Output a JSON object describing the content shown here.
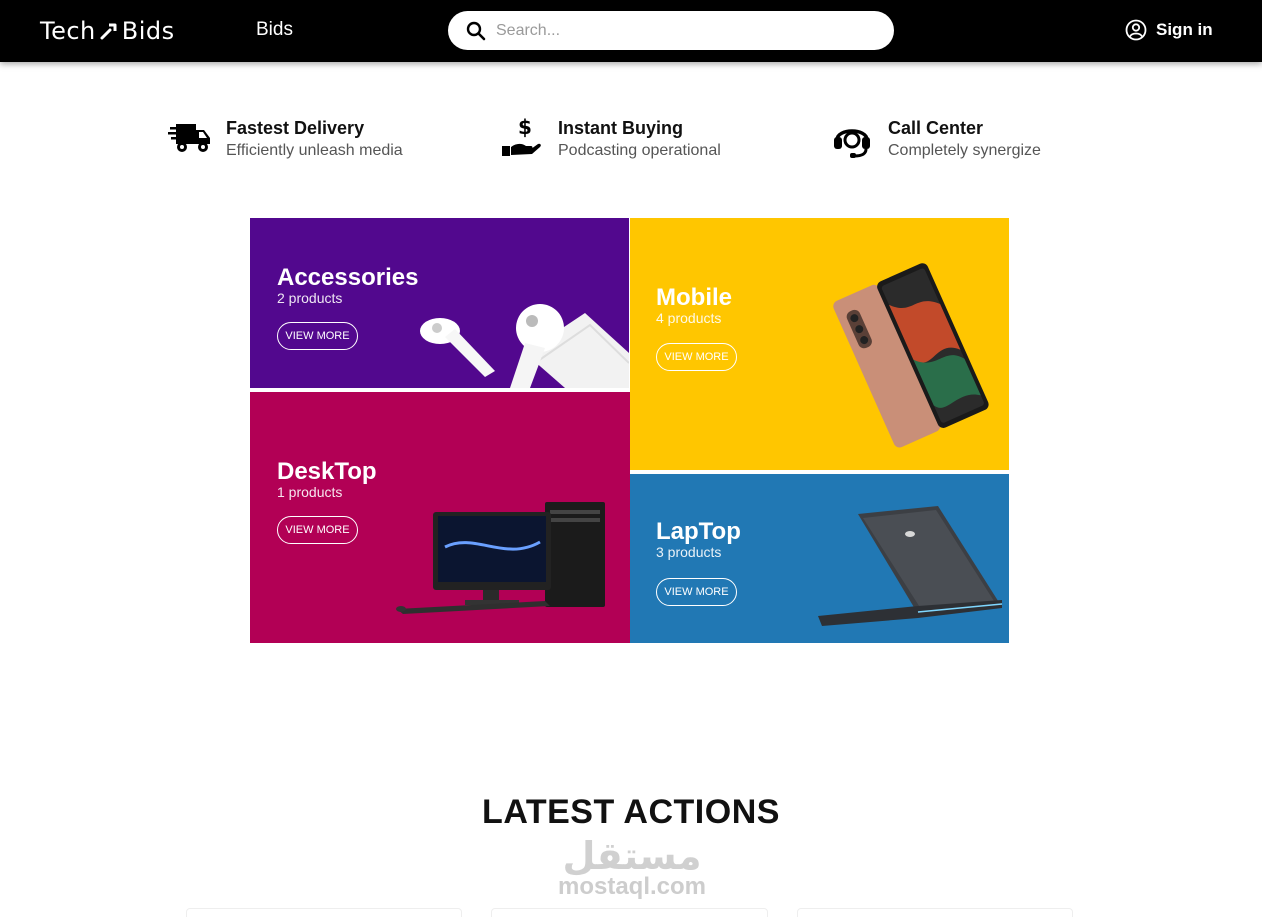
{
  "navbar": {
    "logo_left": "Tech",
    "logo_right": "Bids",
    "nav_link": "Bids",
    "search_placeholder": "Search...",
    "signin_label": "Sign in"
  },
  "features": [
    {
      "icon": "delivery-truck-icon",
      "title": "Fastest Delivery",
      "subtitle": "Efficiently unleash media"
    },
    {
      "icon": "hand-dollar-icon",
      "title": "Instant Buying",
      "subtitle": "Podcasting operational"
    },
    {
      "icon": "headset-icon",
      "title": "Call Center",
      "subtitle": "Completely synergize"
    }
  ],
  "categories": [
    {
      "name": "Accessories",
      "count": "2 products",
      "button": "VIEW MORE",
      "color": "#52088e"
    },
    {
      "name": "Mobile",
      "count": "4 products",
      "button": "VIEW MORE",
      "color": "#ffc600"
    },
    {
      "name": "DeskTop",
      "count": "1 products",
      "button": "VIEW MORE",
      "color": "#b20055"
    },
    {
      "name": "LapTop",
      "count": "3 products",
      "button": "VIEW MORE",
      "color": "#2178b4"
    }
  ],
  "section_title": "LATEST ACTIONS",
  "watermark": {
    "arabic": "مستقل",
    "latin": "mostaql.com"
  }
}
